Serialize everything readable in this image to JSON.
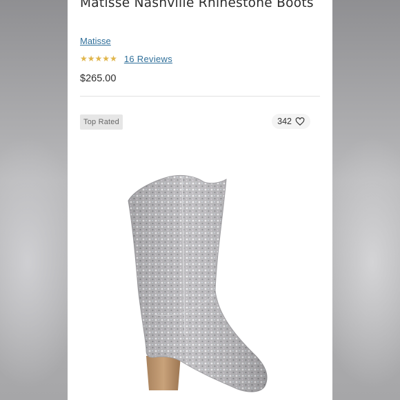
{
  "product": {
    "title": "Matisse Nashville Rhinestone Boots",
    "brand": "Matisse",
    "rating_value": 5,
    "reviews_label": "16 Reviews",
    "price": "$265.00"
  },
  "image_panel": {
    "badge": "Top Rated",
    "likes_count": "342"
  },
  "icons": {
    "rating": "star-icon",
    "like": "heart-outline-icon",
    "photo": "rhinestone-boot-image"
  },
  "colors": {
    "star": "#e0b54a",
    "link": "#2f6f9a",
    "text": "#2b2b2b",
    "badge_bg": "#e6e6e6"
  }
}
